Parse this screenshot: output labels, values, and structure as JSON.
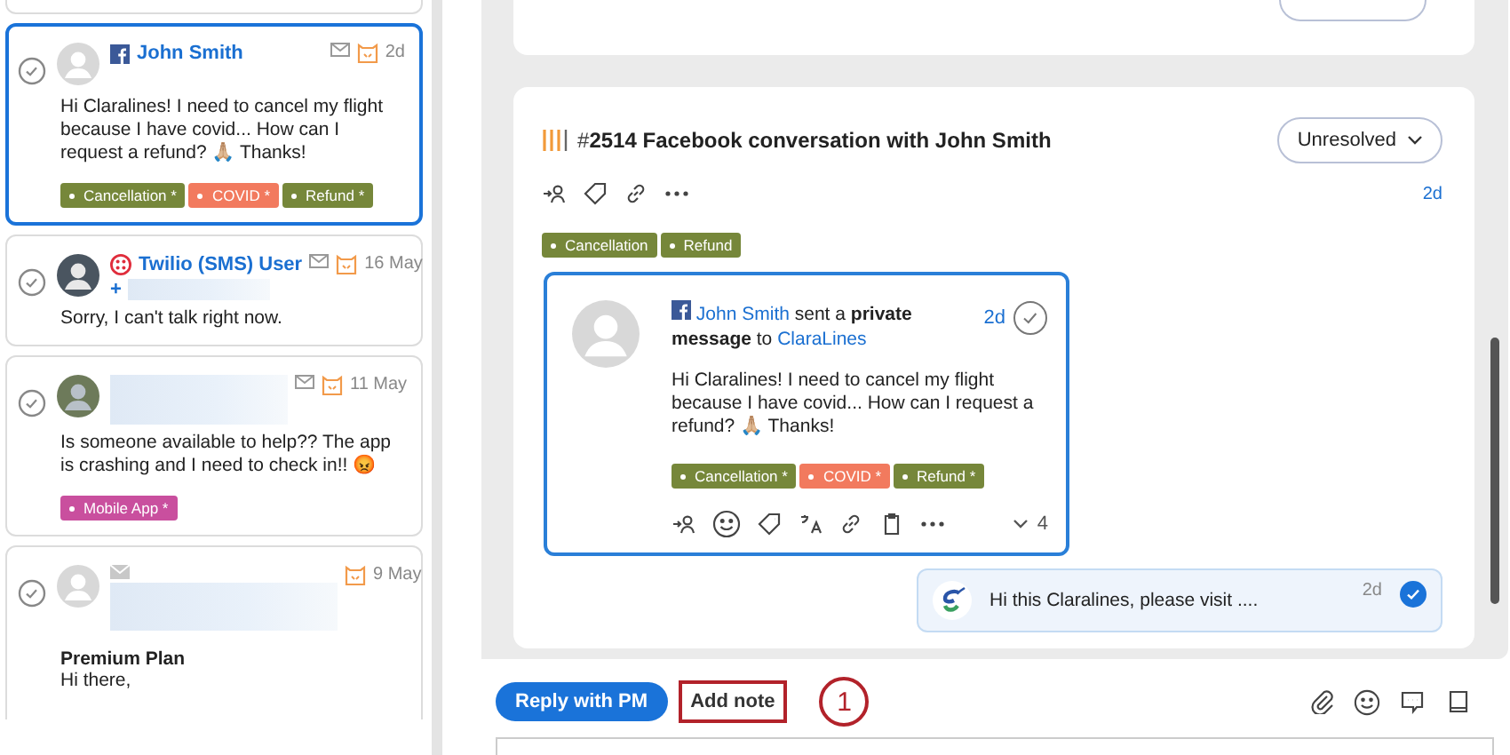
{
  "conversations": [
    {
      "selected": true,
      "kind": "facebook",
      "avatar": {
        "kind": "blank"
      },
      "name": "John Smith",
      "time": "2d",
      "message": "Hi Claralines! I need to cancel my flight because I have covid... How can I request a refund? 🙏🏼 Thanks!",
      "tags": [
        {
          "label": "Cancellation *",
          "color": "#76873a"
        },
        {
          "label": "COVID *",
          "color": "#f27a5e"
        },
        {
          "label": "Refund *",
          "color": "#76873a"
        }
      ]
    },
    {
      "selected": false,
      "kind": "sms",
      "avatar": {
        "kind": "dark"
      },
      "name": "Twilio (SMS) User",
      "phone_prefix": "+",
      "time": "16 May",
      "message": "Sorry, I can't talk right now."
    },
    {
      "selected": false,
      "kind": "plain",
      "avatar": {
        "kind": "photo"
      },
      "time": "11 May",
      "message": "Is someone available to help?? The app is crashing and I need to check in!! 😡",
      "tags": [
        {
          "label": "Mobile App *",
          "color": "#c94f9e"
        }
      ]
    },
    {
      "selected": false,
      "kind": "email",
      "avatar": {
        "kind": "blank"
      },
      "time": "9 May",
      "subject": "Premium Plan",
      "message": "Hi there,"
    }
  ],
  "thread": {
    "hash": "#",
    "number": "2514",
    "title": "Facebook conversation with John Smith",
    "status": "Unresolved",
    "time": "2d",
    "tags": [
      {
        "label": "Cancellation",
        "color": "#76873a"
      },
      {
        "label": "Refund",
        "color": "#76873a"
      }
    ],
    "message": {
      "sender": "John Smith",
      "verb": "sent a",
      "kind_text": "private message",
      "to": "to",
      "recipient": "ClaraLines",
      "time": "2d",
      "text": "Hi Claralines! I need to cancel my flight because I have covid... How can I request a refund? 🙏🏼 Thanks!",
      "tags": [
        {
          "label": "Cancellation *",
          "color": "#76873a"
        },
        {
          "label": "COVID *",
          "color": "#f27a5e"
        },
        {
          "label": "Refund *",
          "color": "#76873a"
        }
      ],
      "reply_count": "4"
    },
    "reply": {
      "text": "Hi this Claralines, please visit ....",
      "time": "2d"
    }
  },
  "composer": {
    "tabs": [
      {
        "label": "Reply with PM",
        "selected": true
      },
      {
        "label": "Add note",
        "selected": false
      }
    ],
    "callout": "1"
  }
}
